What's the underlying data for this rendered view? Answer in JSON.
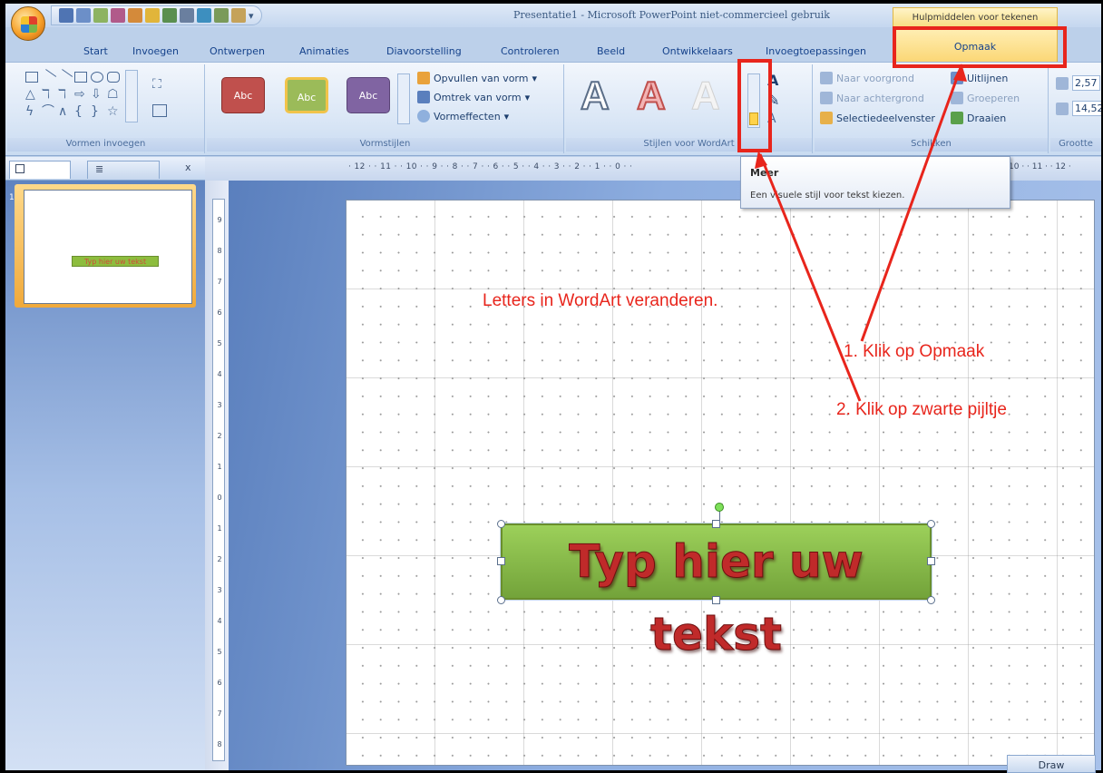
{
  "app": {
    "window_title": "Presentatie1 - Microsoft PowerPoint niet-commercieel gebruik",
    "context_tab_group": "Hulpmiddelen voor tekenen"
  },
  "quick_access": [
    "save-icon",
    "undo-icon",
    "redo-icon",
    "new-slide-icon",
    "spelling-icon",
    "open-icon",
    "print-icon"
  ],
  "tabs": [
    "Start",
    "Invoegen",
    "Ontwerpen",
    "Animaties",
    "Diavoorstelling",
    "Controleren",
    "Beeld",
    "Ontwikkelaars",
    "Invoegtoepassingen",
    "Opmaak"
  ],
  "ribbon": {
    "groups": {
      "shapes": "Vormen invoegen",
      "shape_styles": "Vormstijlen",
      "wordart_styles": "Stijlen voor WordArt",
      "arrange": "Schikken",
      "size": "Grootte"
    },
    "style_swatches": [
      {
        "label": "Abc",
        "color": "#c0504d"
      },
      {
        "label": "Abc",
        "color": "#9bbb59"
      },
      {
        "label": "Abc",
        "color": "#8064a2"
      }
    ],
    "shape_menu": [
      "Opvullen van vorm",
      "Omtrek van vorm",
      "Vormeffecten"
    ],
    "wordart_letters": [
      "A",
      "A",
      "A"
    ],
    "arrange_left": [
      "Naar voorgrond",
      "Naar achtergrond",
      "Selectiedeelvenster"
    ],
    "arrange_right": [
      "Uitlijnen",
      "Groeperen",
      "Draaien"
    ],
    "size_values": [
      "2,57",
      "14,52"
    ]
  },
  "tooltip": {
    "title": "Meer",
    "body": "Een visuele stijl voor tekst kiezen."
  },
  "left_panel": {
    "close_label": "x",
    "slide_number": "1",
    "thumb_text": "Typ hier uw tekst"
  },
  "rulers": {
    "horizontal": "· 12 · · 11 · · 10 · · 9 · · 8 · · 7 · · 6 · · 5 · · 4 · · 3 · · 2 · · 1 · · 0 · ·",
    "horizontal_right": "10 · · 11 · · 12 ·",
    "vertical": [
      "9",
      "8",
      "7",
      "6",
      "5",
      "4",
      "3",
      "2",
      "1",
      "0",
      "1",
      "2",
      "3",
      "4",
      "5",
      "6",
      "7",
      "8",
      "9"
    ]
  },
  "slide": {
    "wordart_text": "Typ hier uw tekst"
  },
  "annotations": {
    "heading": "Letters in WordArt veranderen.",
    "step1": "1. Klik op Opmaak",
    "step2": "2. Klik op zwarte pijltje"
  },
  "status": {
    "draw_label": "Draw"
  },
  "colors": {
    "annotation_red": "#e8251c",
    "context_tab": "#f7dd80"
  }
}
